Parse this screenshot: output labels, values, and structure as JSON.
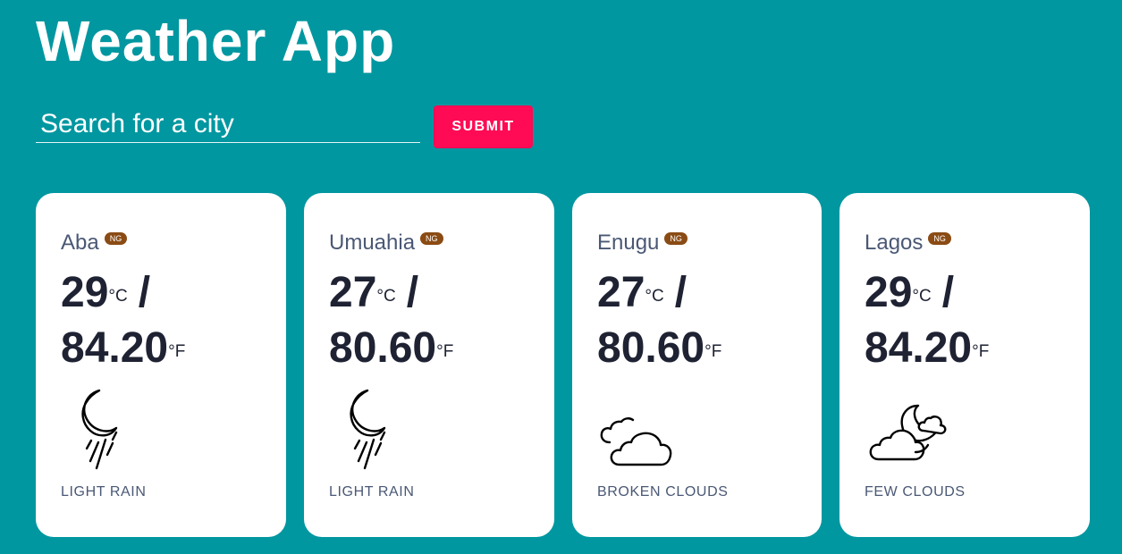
{
  "app": {
    "title": "Weather App"
  },
  "search": {
    "placeholder": "Search for a city",
    "value": "",
    "submit_label": "SUBMIT"
  },
  "colors": {
    "background": "#0097a0",
    "submit_button": "#ff0a54",
    "card": "#ffffff",
    "country_badge": "#8a4b14"
  },
  "cities": [
    {
      "name": "Aba",
      "country": "NG",
      "temp_c": "29",
      "unit_c": "°C",
      "separator": "/",
      "temp_f": "84.20",
      "unit_f": "°F",
      "icon": "moon-rain-icon",
      "description": "LIGHT RAIN"
    },
    {
      "name": "Umuahia",
      "country": "NG",
      "temp_c": "27",
      "unit_c": "°C",
      "separator": "/",
      "temp_f": "80.60",
      "unit_f": "°F",
      "icon": "moon-rain-icon",
      "description": "LIGHT RAIN"
    },
    {
      "name": "Enugu",
      "country": "NG",
      "temp_c": "27",
      "unit_c": "°C",
      "separator": "/",
      "temp_f": "80.60",
      "unit_f": "°F",
      "icon": "broken-clouds-icon",
      "description": "BROKEN CLOUDS"
    },
    {
      "name": "Lagos",
      "country": "NG",
      "temp_c": "29",
      "unit_c": "°C",
      "separator": "/",
      "temp_f": "84.20",
      "unit_f": "°F",
      "icon": "few-clouds-night-icon",
      "description": "FEW CLOUDS"
    }
  ]
}
